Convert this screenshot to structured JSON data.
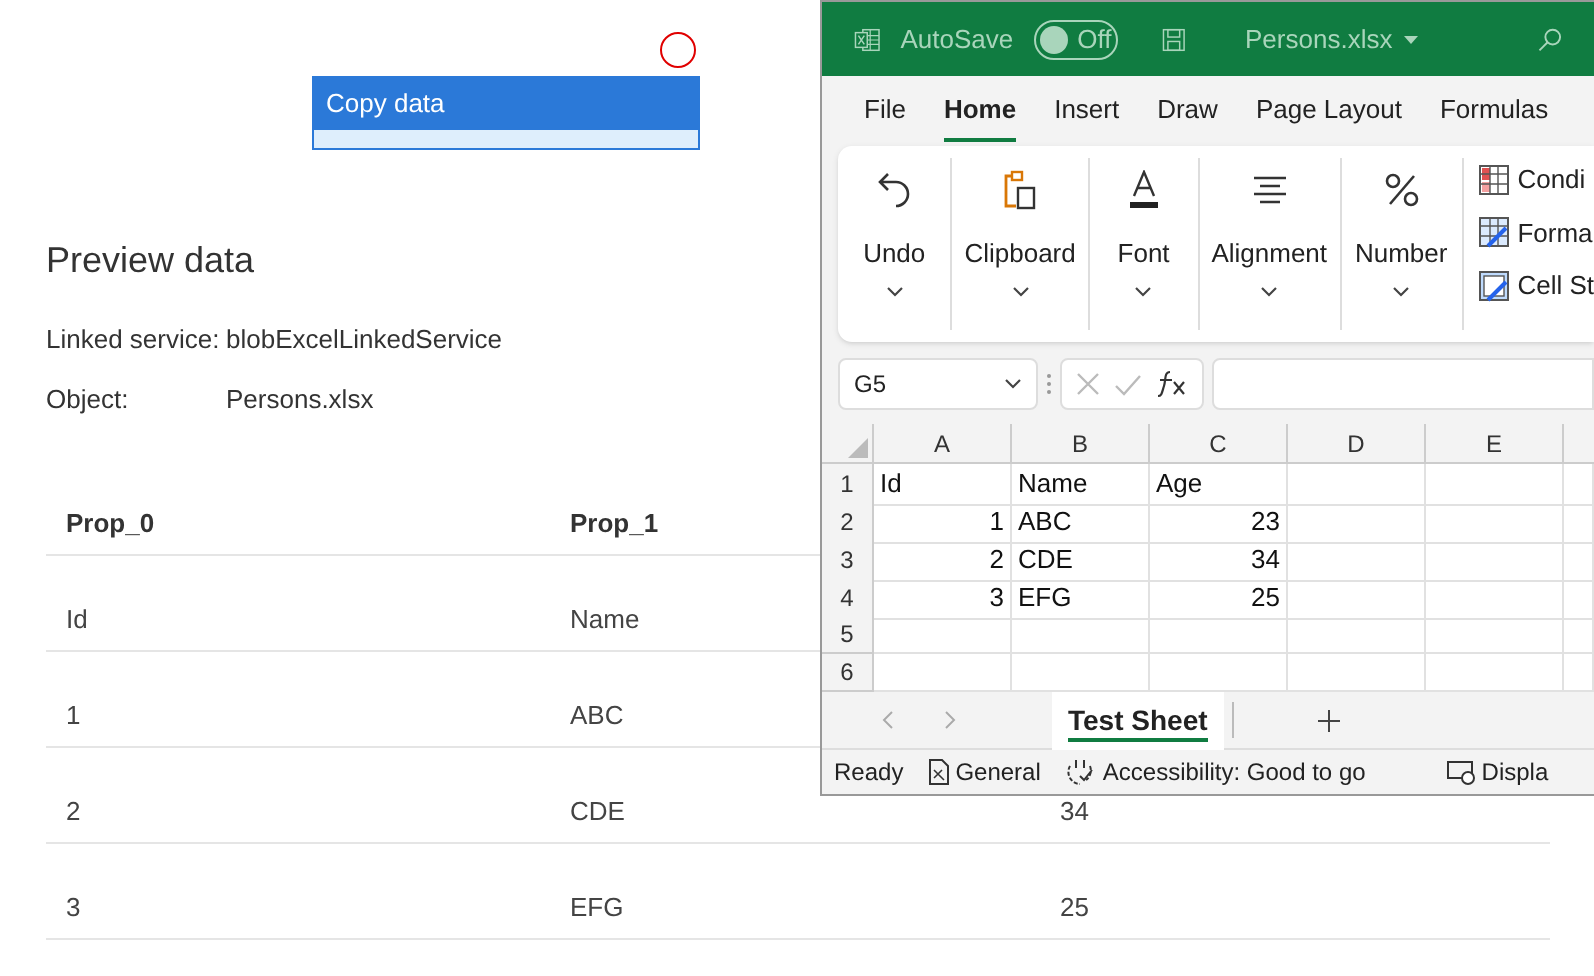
{
  "canvas": {
    "activity": {
      "title": "Copy data"
    }
  },
  "preview": {
    "title": "Preview data",
    "fields": [
      {
        "label": "Linked service:",
        "value": "blobExcelLinkedService"
      },
      {
        "label": "Object:",
        "value": "Persons.xlsx"
      }
    ],
    "table": {
      "columns": [
        "Prop_0",
        "Prop_1"
      ],
      "rows": [
        [
          "Id",
          "Name"
        ],
        [
          "1",
          "ABC"
        ],
        [
          "2",
          "CDE",
          "34"
        ],
        [
          "3",
          "EFG",
          "25"
        ]
      ]
    }
  },
  "excel": {
    "title_bar": {
      "autosave_label": "AutoSave",
      "autosave": {
        "on": false,
        "label": "Off"
      },
      "file_name": "Persons.xlsx"
    },
    "tabs": [
      {
        "label": "File",
        "selected": false
      },
      {
        "label": "Home",
        "selected": true
      },
      {
        "label": "Insert",
        "selected": false
      },
      {
        "label": "Draw",
        "selected": false
      },
      {
        "label": "Page Layout",
        "selected": false
      },
      {
        "label": "Formulas",
        "selected": false
      }
    ],
    "ribbon_groups": [
      "Undo",
      "Clipboard",
      "Font",
      "Alignment",
      "Number"
    ],
    "styles_items": [
      "Condi",
      "Forma",
      "Cell St"
    ],
    "name_box": "G5",
    "grid": {
      "columns": [
        "A",
        "B",
        "C",
        "D",
        "E"
      ],
      "rows": [
        {
          "header": "1",
          "cells": [
            {
              "text": "Id",
              "kind": "text"
            },
            {
              "text": "Name",
              "kind": "text"
            },
            {
              "text": "Age",
              "kind": "text"
            }
          ]
        },
        {
          "header": "2",
          "cells": [
            {
              "text": "1",
              "kind": "number"
            },
            {
              "text": "ABC",
              "kind": "text"
            },
            {
              "text": "23",
              "kind": "number"
            }
          ]
        },
        {
          "header": "3",
          "cells": [
            {
              "text": "2",
              "kind": "number"
            },
            {
              "text": "CDE",
              "kind": "text"
            },
            {
              "text": "34",
              "kind": "number"
            }
          ]
        },
        {
          "header": "4",
          "cells": [
            {
              "text": "3",
              "kind": "number"
            },
            {
              "text": "EFG",
              "kind": "text"
            },
            {
              "text": "25",
              "kind": "number"
            }
          ]
        },
        {
          "header": "5",
          "cells": []
        },
        {
          "header": "6",
          "cells": []
        }
      ]
    },
    "sheet_tabs": [
      {
        "label": "Test Sheet",
        "selected": true
      }
    ],
    "status_bar": [
      "Ready",
      "General",
      "Accessibility: Good to go",
      "Displa"
    ]
  }
}
